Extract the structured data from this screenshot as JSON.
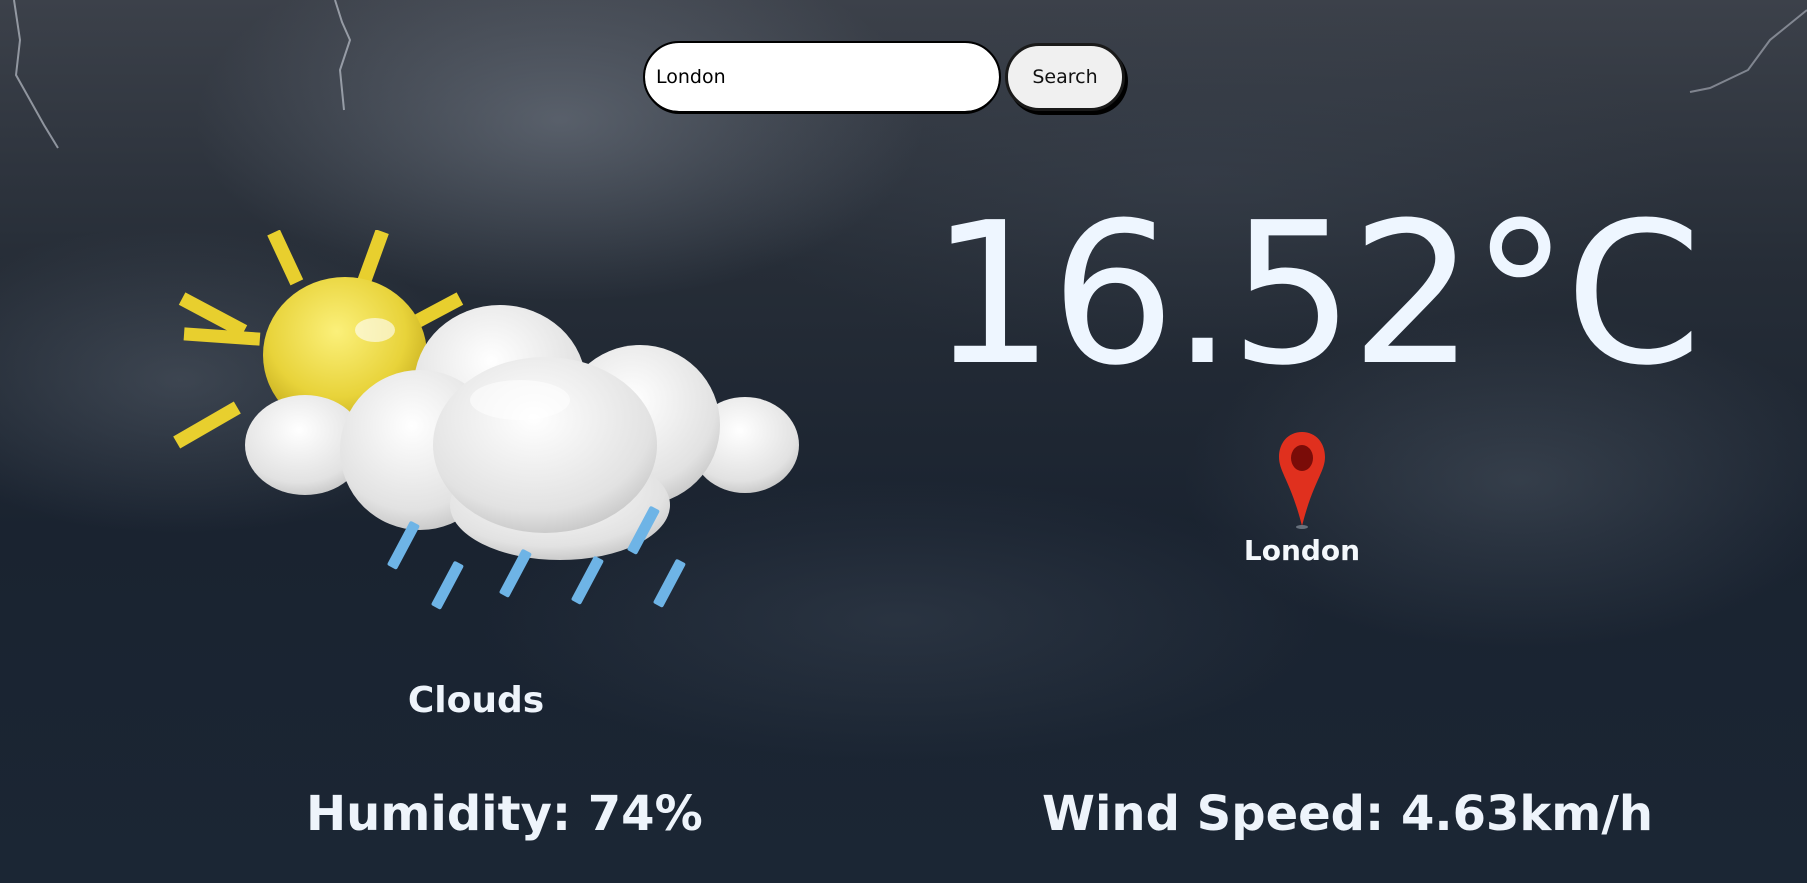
{
  "search": {
    "value": "London",
    "button_label": "Search"
  },
  "weather": {
    "temperature": "16.52°C",
    "condition": "Clouds",
    "location": "London",
    "humidity": "Humidity: 74%",
    "wind_speed": "Wind Speed: 4.63km/h"
  },
  "icons": {
    "weather": "sun-behind-cloud-rain-icon",
    "location": "map-pin-icon"
  },
  "colors": {
    "sun": "#e8d33a",
    "cloud": "#e4e4e4",
    "rain": "#6eb4e6",
    "pin": "#e0301e",
    "text": "#eef4fb"
  }
}
